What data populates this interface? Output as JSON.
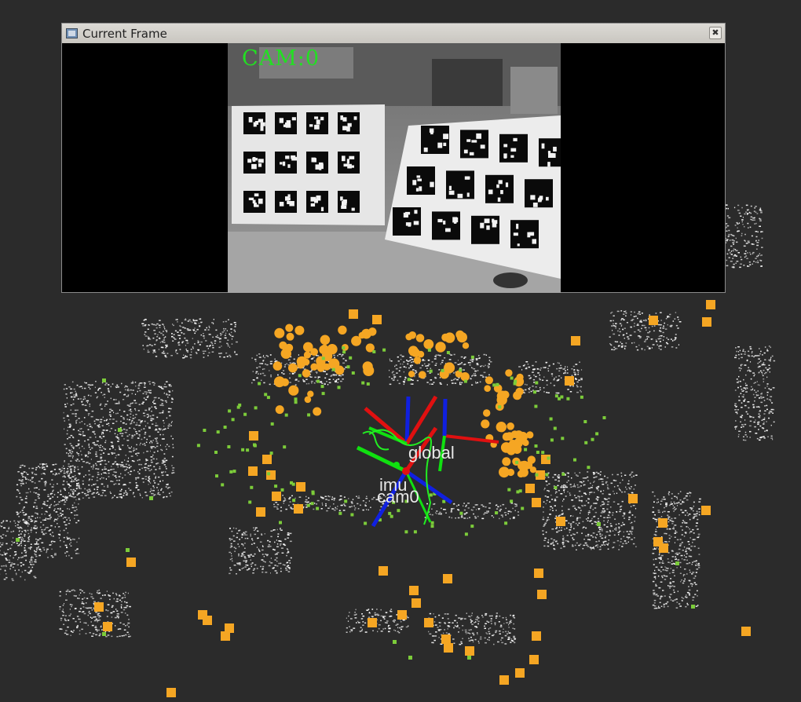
{
  "window": {
    "title": "Current Frame",
    "close_glyph": "✖",
    "icon": "image-window-icon"
  },
  "camera": {
    "label": "CAM:0"
  },
  "scene": {
    "frame_labels": [
      "imu",
      "global",
      "cam0"
    ],
    "colors": {
      "background": "#2b2b2b",
      "points": "#ffffff",
      "features": "#f5a623",
      "tracked": "#7ccc3a",
      "axis_x": "#e01010",
      "axis_y": "#10e010",
      "axis_z": "#1020e0",
      "cam_text": "#22e022"
    }
  }
}
